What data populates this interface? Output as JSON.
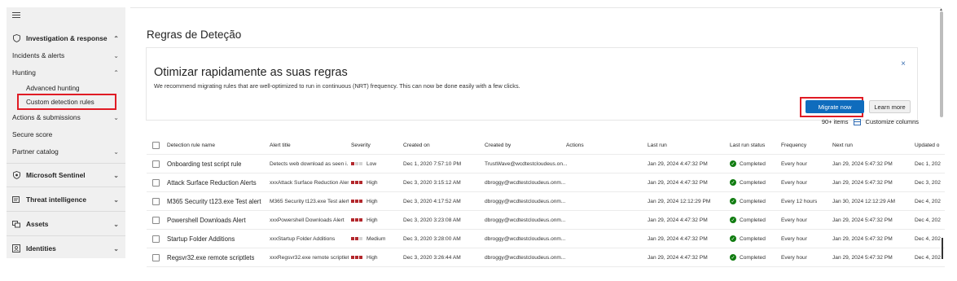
{
  "sidebar": {
    "investigation": "Investigation & response",
    "incidents": "Incidents & alerts",
    "hunting": "Hunting",
    "advanced_hunting": "Advanced hunting",
    "custom_detection_rules": "Custom detection rules",
    "actions": "Actions & submissions",
    "secure_score": "Secure score",
    "partner_catalog": "Partner catalog",
    "sentinel": "Microsoft Sentinel",
    "threat_intel": "Threat intelligence",
    "assets": "Assets",
    "identities": "Identities"
  },
  "page_title": "Regras de Deteção",
  "banner": {
    "title": "Otimizar rapidamente as suas regras",
    "text": "We recommend migrating rules that are well-optimized to run in continuous (NRT) frequency. This can now be done easily with a few clicks.",
    "migrate_label": "Migrate now",
    "learn_label": "Learn more",
    "close": "×"
  },
  "toolbar": {
    "count": "90+ items",
    "customize": "Customize columns"
  },
  "table": {
    "headers": {
      "name": "Detection rule name",
      "alert": "Alert title",
      "severity": "Severity",
      "created_on": "Created on",
      "created_by": "Created by",
      "actions": "Actions",
      "last_run": "Last run",
      "last_run_status": "Last run status",
      "frequency": "Frequency",
      "next_run": "Next run",
      "updated": "Updated o"
    },
    "rows": [
      {
        "name": "Onboarding test script rule",
        "alert": "Detects web download as seen i...",
        "severity": "Low",
        "created_on": "Dec 1, 2020 7:57:10 PM",
        "created_by": "TrustWave@wcdtestcloudeus.on...",
        "last_run": "Jan 29, 2024 4:47:32 PM",
        "status": "Completed",
        "frequency": "Every hour",
        "next_run": "Jan 29, 2024 5:47:32 PM",
        "updated": "Dec 1, 202"
      },
      {
        "name": "Attack Surface Reduction Alerts",
        "alert": "xxxAttack Surface Reduction Alert",
        "severity": "High",
        "created_on": "Dec 3, 2020 3:15:12 AM",
        "created_by": "dbroggy@wcdtestcloudeus.onm...",
        "last_run": "Jan 29, 2024 4:47:32 PM",
        "status": "Completed",
        "frequency": "Every hour",
        "next_run": "Jan 29, 2024 5:47:32 PM",
        "updated": "Dec 3, 202"
      },
      {
        "name": "M365 Security t123.exe Test alert",
        "alert": "M365 Security t123.exe Test alert",
        "severity": "High",
        "created_on": "Dec 3, 2020 4:17:52 AM",
        "created_by": "dbroggy@wcdtestcloudeus.onm...",
        "last_run": "Jan 29, 2024 12:12:29 PM",
        "status": "Completed",
        "frequency": "Every 12 hours",
        "next_run": "Jan 30, 2024 12:12:29 AM",
        "updated": "Dec 4, 202"
      },
      {
        "name": "Powershell Downloads Alert",
        "alert": "xxxPowershell Downloads Alert",
        "severity": "High",
        "created_on": "Dec 3, 2020 3:23:08 AM",
        "created_by": "dbroggy@wcdtestcloudeus.onm...",
        "last_run": "Jan 29, 2024 4:47:32 PM",
        "status": "Completed",
        "frequency": "Every hour",
        "next_run": "Jan 29, 2024 5:47:32 PM",
        "updated": "Dec 4, 202"
      },
      {
        "name": "Startup Folder Additions",
        "alert": "xxxStartup Folder Additions",
        "severity": "Medium",
        "created_on": "Dec 3, 2020 3:28:00 AM",
        "created_by": "dbroggy@wcdtestcloudeus.onm...",
        "last_run": "Jan 29, 2024 4:47:32 PM",
        "status": "Completed",
        "frequency": "Every hour",
        "next_run": "Jan 29, 2024 5:47:32 PM",
        "updated": "Dec 4, 202"
      },
      {
        "name": "Regsvr32.exe remote scriptlets",
        "alert": "xxxRegsvr32.exe remote scriptlets",
        "severity": "High",
        "created_on": "Dec 3, 2020 3:26:44 AM",
        "created_by": "dbroggy@wcdtestcloudeus.onm...",
        "last_run": "Jan 29, 2024 4:47:32 PM",
        "status": "Completed",
        "frequency": "Every hour",
        "next_run": "Jan 29, 2024 5:47:32 PM",
        "updated": "Dec 4, 202"
      }
    ]
  },
  "colors": {
    "accent": "#0f6cbd",
    "highlight": "#e01b24",
    "severity": "#b3282d",
    "success": "#107c10"
  }
}
